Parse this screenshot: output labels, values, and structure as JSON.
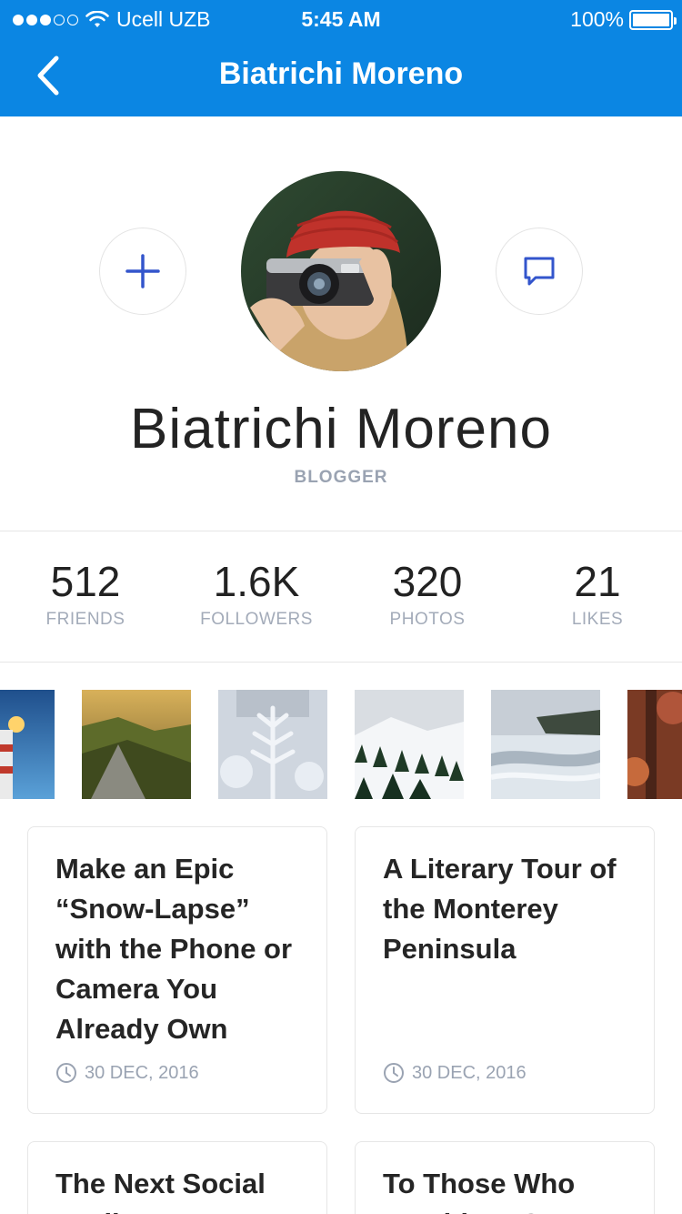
{
  "status_bar": {
    "carrier": "Ucell UZB",
    "time": "5:45 AM",
    "battery": "100%"
  },
  "header": {
    "title": "Biatrichi Moreno"
  },
  "profile": {
    "name": "Biatrichi Moreno",
    "role": "BLOGGER"
  },
  "stats": [
    {
      "value": "512",
      "label": "FRIENDS"
    },
    {
      "value": "1.6K",
      "label": "FOLLOWERS"
    },
    {
      "value": "320",
      "label": "PHOTOS"
    },
    {
      "value": "21",
      "label": "LIKES"
    }
  ],
  "articles": [
    {
      "title": "Make an Epic “Snow-Lapse” with the Phone or Camera You Already Own",
      "date": "30 DEC, 2016"
    },
    {
      "title": "A Literary Tour of the Monterey Peninsula",
      "date": "30 DEC, 2016"
    },
    {
      "title": "The Next Social Media We Want",
      "date": ""
    },
    {
      "title": "To Those Who Would Be G",
      "date": ""
    }
  ],
  "colors": {
    "accent": "#0b86e3",
    "icon": "#3355cc",
    "muted": "#9aa3b2"
  },
  "icons": {
    "back": "chevron-left-icon",
    "add": "plus-icon",
    "message": "chat-bubble-icon",
    "date": "clock-icon"
  }
}
